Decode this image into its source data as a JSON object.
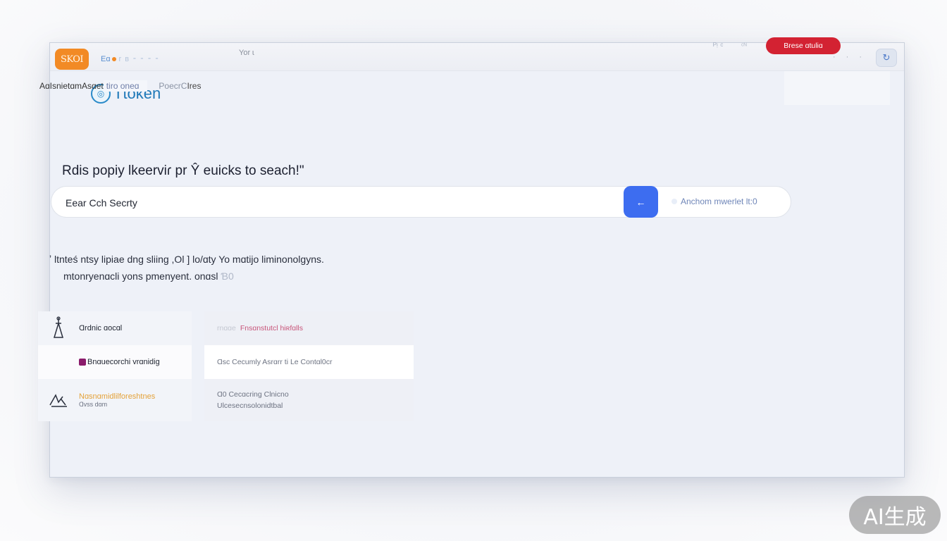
{
  "titlebar": {
    "app_badge": "SKOI",
    "tab_label": "Eɑ",
    "tab_faint": "r ʙ ⁃ ⁃ ⁃ ⁃",
    "tab_title": "Yor ɩ",
    "dots": "· · ·",
    "button_icon": "refresh-icon"
  },
  "header": {
    "logo_icon": "location-pin-icon",
    "logo_text": "Ttoken",
    "faint_1": "ᴾᵎ ᶜ",
    "faint_2": "ᶜᴺ",
    "primary_button": "Brese ɑtuliɑ"
  },
  "subnav": {
    "active": "AɑIsnietɑmAsɑet",
    "muted": "tiro oneɑ",
    "secondary_faint": "PoecrC",
    "secondary": "Ires"
  },
  "search": {
    "heading": "Rdis popiy lkeerviɾ pr Ŷ euicks to seach!\"",
    "value": "Eear Cch Secrty",
    "button_icon": "arrow-left-icon",
    "advanced": "Anchom mwerlet lt:0"
  },
  "description": {
    "line1": "ʼ ltnteś ntsy lipiae dng sliing ,Ol ] lo/ɑty Yo mɑtijo liminonolgyns.",
    "line2": "mtonryenɑcli yons pmenyent. onɑsl",
    "line2_fade": "Ɓ0"
  },
  "left_list": [
    {
      "icon": "lamp-icon",
      "label": "Ɑrdnic ɑocɑl"
    },
    {
      "icon": "",
      "label": "Bnɑuecorchi vrɑnidig"
    },
    {
      "icon": "signature-icon",
      "label": "Nɑsnɑmidlilforeshtnes",
      "sub": "Ɑvss dɑm"
    }
  ],
  "right_list": [
    {
      "prefix": "rnɑɑe",
      "label": "Fnsɑnstutcl hiʀfɑlls"
    },
    {
      "label": "Ɑsc Cecumly Asrɑrr ti Le Contɑl0cr"
    },
    {
      "label": "Ɑ0  Cecɑcring Clnicno",
      "sub": "Ulcesecnsolonidtbal"
    }
  ],
  "watermark": "AI生成"
}
